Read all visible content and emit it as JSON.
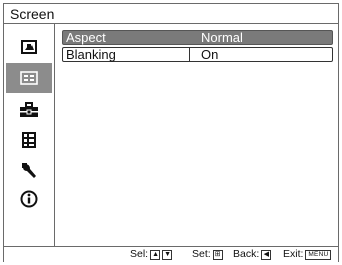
{
  "title": "Screen",
  "sidebar": {
    "items": [
      {
        "icon": "picture-icon",
        "selected": false
      },
      {
        "icon": "screen-icon",
        "selected": true
      },
      {
        "icon": "toolbox-icon",
        "selected": false
      },
      {
        "icon": "list-menu-icon",
        "selected": false
      },
      {
        "icon": "wrench-icon",
        "selected": false
      },
      {
        "icon": "info-icon",
        "selected": false
      }
    ]
  },
  "rows": [
    {
      "label": "Aspect",
      "value": "Normal",
      "selected": true
    },
    {
      "label": "Blanking",
      "value": "On",
      "selected": false
    }
  ],
  "footer": {
    "sel_label": "Sel:",
    "up_key": "▲",
    "down_key": "▼",
    "set_label": "Set:",
    "set_key": "⊞",
    "back_label": "Back:",
    "back_key": "◀",
    "exit_label": "Exit:",
    "exit_key": "MENU"
  },
  "colors": {
    "selected_bg": "#7a7a7a",
    "sidebar_selected_bg": "#8c8c8c",
    "border": "#6a6a6a"
  }
}
